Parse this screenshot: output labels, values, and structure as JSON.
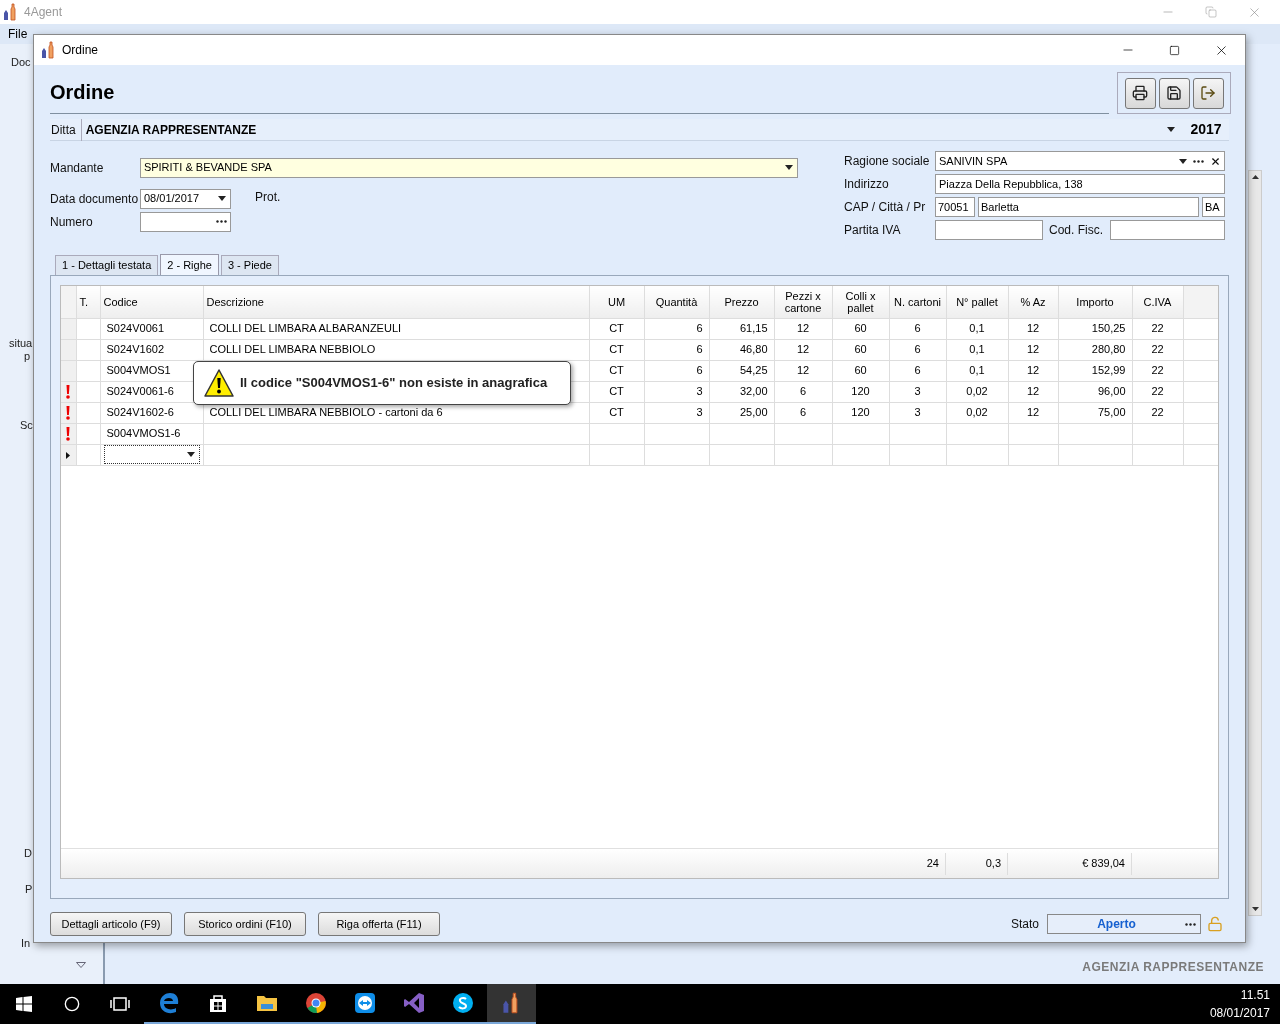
{
  "app": {
    "title": "4Agent",
    "menu": [
      "File"
    ],
    "sidebar_fragments": [
      "Doc",
      "situa",
      "p",
      "Sc",
      "D",
      "P",
      "In"
    ],
    "footer": "AGENZIA RAPPRESENTANZE"
  },
  "dialog": {
    "title": "Ordine",
    "heading": "Ordine",
    "ditta": {
      "label": "Ditta",
      "value": "AGENZIA RAPPRESENTANZE",
      "year": "2017"
    },
    "form": {
      "mandante": {
        "label": "Mandante",
        "value": "SPIRITI & BEVANDE SPA"
      },
      "data_documento": {
        "label": "Data documento",
        "value": "08/01/2017"
      },
      "prot": {
        "label": "Prot."
      },
      "numero": {
        "label": "Numero"
      },
      "ragione_sociale": {
        "label": "Ragione sociale",
        "value": "SANIVIN SPA"
      },
      "indirizzo": {
        "label": "Indirizzo",
        "value": "Piazza Della Repubblica, 138"
      },
      "cap_citta_pr": {
        "label": "CAP / Città / Pr",
        "cap": "70051",
        "citta": "Barletta",
        "pr": "BA"
      },
      "partita_iva": {
        "label": "Partita IVA"
      },
      "cod_fisc": {
        "label": "Cod. Fisc."
      }
    },
    "tabs": [
      {
        "label": "1 - Dettagli testata",
        "selected": false
      },
      {
        "label": "2 - Righe",
        "selected": true
      },
      {
        "label": "3 - Piede",
        "selected": false
      }
    ],
    "table": {
      "columns": [
        "T.",
        "Codice",
        "Descrizione",
        "UM",
        "Quantità",
        "Prezzo",
        "Pezzi x cartone",
        "Colli x pallet",
        "N. cartoni",
        "N° pallet",
        "% Az",
        "Importo",
        "C.IVA"
      ],
      "rows": [
        {
          "error": false,
          "current": false,
          "cells": [
            "",
            "S024V0061",
            "COLLI DEL LIMBARA ALBARANZEULI",
            "CT",
            "6",
            "61,15",
            "12",
            "60",
            "6",
            "0,1",
            "12",
            "150,25",
            "22"
          ]
        },
        {
          "error": false,
          "current": false,
          "cells": [
            "",
            "S024V1602",
            "COLLI DEL LIMBARA NEBBIOLO",
            "CT",
            "6",
            "46,80",
            "12",
            "60",
            "6",
            "0,1",
            "12",
            "280,80",
            "22"
          ]
        },
        {
          "error": false,
          "current": false,
          "cells": [
            "",
            "S004VMOS1",
            "",
            "CT",
            "6",
            "54,25",
            "12",
            "60",
            "6",
            "0,1",
            "12",
            "152,99",
            "22"
          ]
        },
        {
          "error": true,
          "current": false,
          "cells": [
            "",
            "S024V0061-6",
            "",
            "CT",
            "3",
            "32,00",
            "6",
            "120",
            "3",
            "0,02",
            "12",
            "96,00",
            "22"
          ]
        },
        {
          "error": true,
          "current": false,
          "cells": [
            "",
            "S024V1602-6",
            "COLLI DEL LIMBARA NEBBIOLO - cartoni da 6",
            "CT",
            "3",
            "25,00",
            "6",
            "120",
            "3",
            "0,02",
            "12",
            "75,00",
            "22"
          ]
        },
        {
          "error": true,
          "current": false,
          "cells": [
            "",
            "S004VMOS1-6",
            "",
            "",
            "",
            "",
            "",
            "",
            "",
            "",
            "",
            "",
            ""
          ]
        },
        {
          "error": false,
          "current": true,
          "cells": [
            "",
            "",
            "",
            "",
            "",
            "",
            "",
            "",
            "",
            "",
            "",
            "",
            ""
          ]
        }
      ],
      "totals": {
        "n_cartoni": "24",
        "n_pallet": "0,3",
        "importo": "€ 839,04"
      }
    },
    "tooltip": {
      "message": "Il codice \"S004VMOS1-6\" non esiste in anagrafica"
    },
    "buttons": [
      "Dettagli articolo (F9)",
      "Storico ordini (F10)",
      "Riga offerta (F11)"
    ],
    "stato": {
      "label": "Stato",
      "value": "Aperto"
    }
  },
  "taskbar": {
    "time": "11.51",
    "date": "08/01/2017"
  }
}
